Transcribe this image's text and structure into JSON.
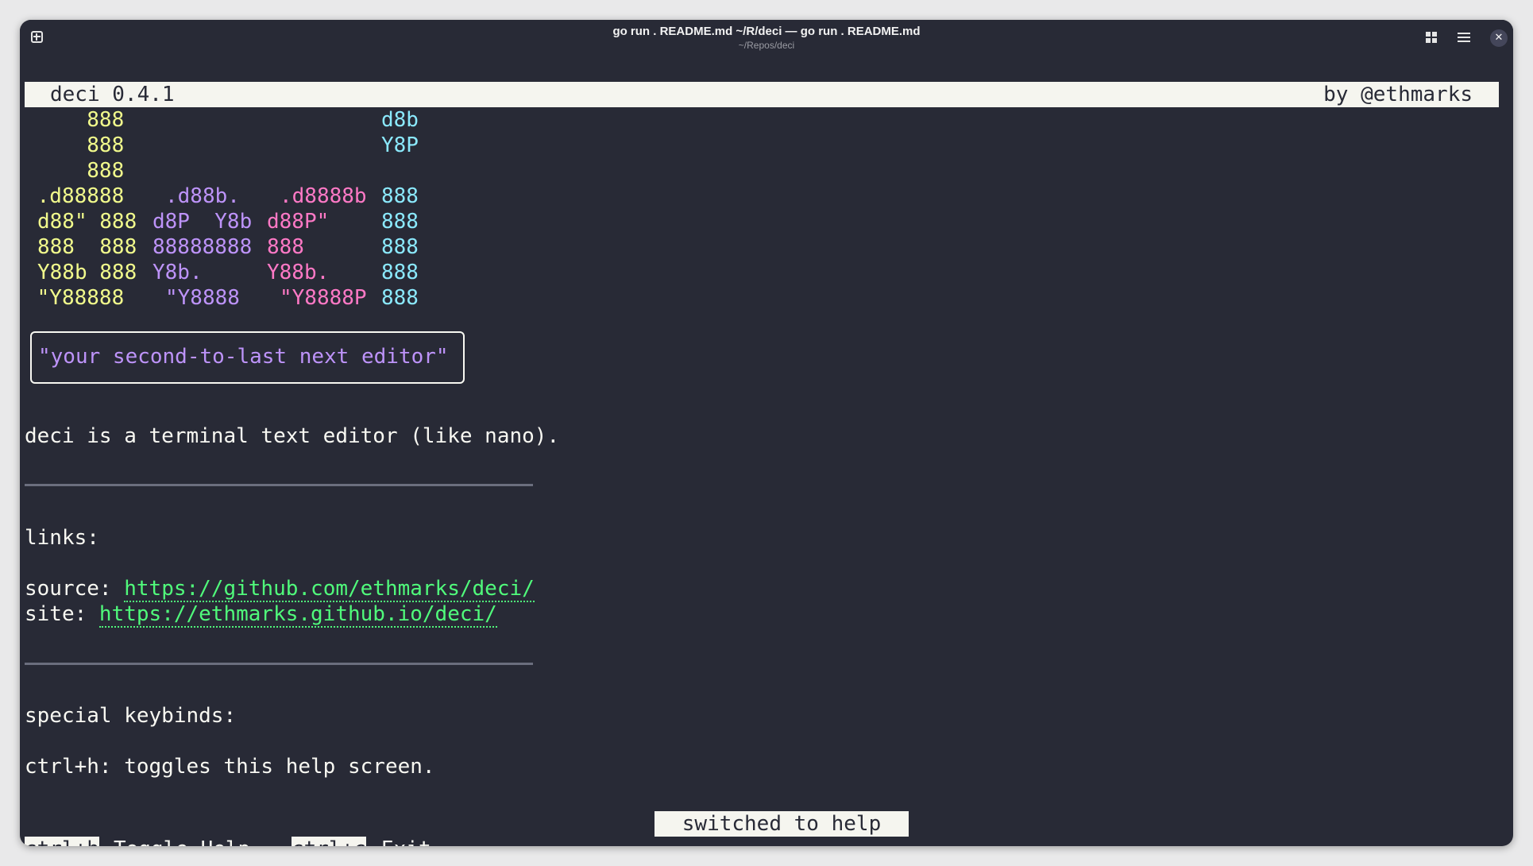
{
  "window": {
    "title": "go run . README.md ~/R/deci — go run . README.md",
    "subtitle": "~/Repos/deci",
    "icons": [
      "new-tab-icon",
      "grid-view-icon",
      "hamburger-menu-icon",
      "close-icon"
    ],
    "close_glyph": "✕"
  },
  "header": {
    "version": "deci 0.4.1",
    "author": "by @ethmarks"
  },
  "logo": {
    "colors": {
      "d": "#f1fa8c",
      "e": "#bd93f9",
      "c": "#ff79c6",
      "i": "#8be9fd"
    },
    "rows": [
      {
        "d": "     888",
        "e": "",
        "c": "",
        "i": "d8b"
      },
      {
        "d": "     888",
        "e": "",
        "c": "",
        "i": "Y8P"
      },
      {
        "d": "     888",
        "e": "",
        "c": "",
        "i": ""
      },
      {
        "d": " .d88888",
        "e": ".d88b.",
        "c": ".d8888b",
        "i": "888"
      },
      {
        "d": "d88\" 888",
        "e": "d8P  Y8b",
        "c": "d88P\"",
        "i": "888"
      },
      {
        "d": "888  888",
        "e": "88888888",
        "c": "888",
        "i": "888"
      },
      {
        "d": "Y88b 888",
        "e": "Y8b.",
        "c": "Y88b.",
        "i": "888"
      },
      {
        "d": " \"Y88888",
        "e": "\"Y8888",
        "c": "\"Y8888P",
        "i": "888"
      }
    ]
  },
  "tagline": "\"your second-to-last next editor\"",
  "description": "deci is a terminal text editor (like nano).",
  "links": {
    "heading": "links:",
    "source_label": "source: ",
    "source_url": "https://github.com/ethmarks/deci/",
    "site_label": "site: ",
    "site_url": "https://ethmarks.github.io/deci/"
  },
  "keybinds": {
    "heading": "special keybinds:",
    "line1": "ctrl+h: toggles this help screen."
  },
  "status_message": "switched to help",
  "footer": {
    "key1": "ctrl+h",
    "label1": "Toggle Help",
    "key2": "ctrl+c",
    "label2": "Exit"
  }
}
